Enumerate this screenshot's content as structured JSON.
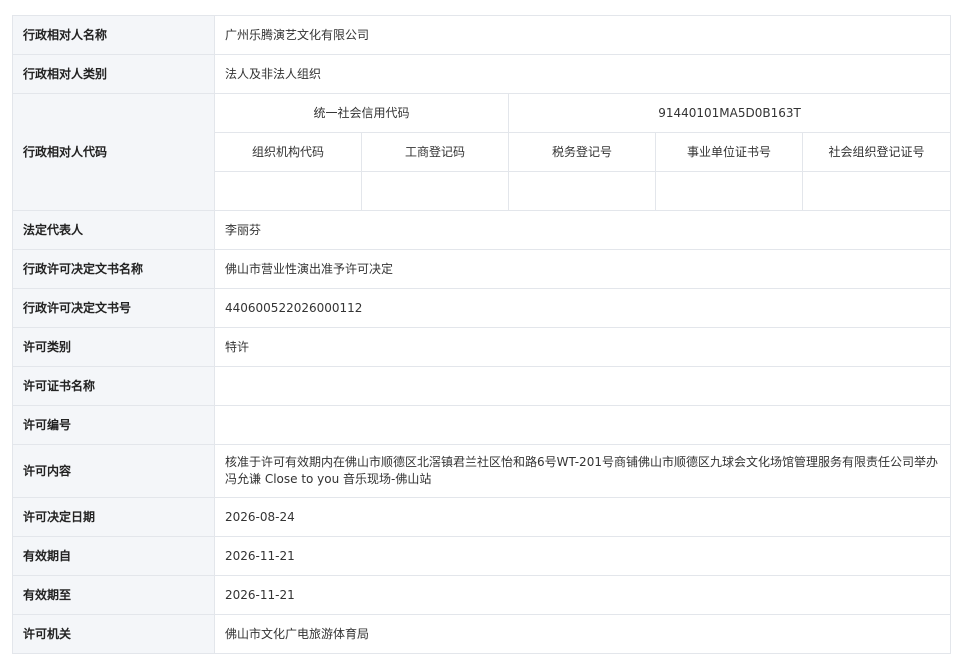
{
  "rows": {
    "name": {
      "label": "行政相对人名称",
      "value": "广州乐腾演艺文化有限公司"
    },
    "category": {
      "label": "行政相对人类别",
      "value": "法人及非法人组织"
    },
    "code": {
      "label": "行政相对人代码",
      "usc_label": "统一社会信用代码",
      "usc_value": "91440101MA5D0B163T",
      "sub_headers": [
        "组织机构代码",
        "工商登记码",
        "税务登记号",
        "事业单位证书号",
        "社会组织登记证号"
      ],
      "sub_values": [
        "",
        "",
        "",
        "",
        ""
      ]
    },
    "legal_rep": {
      "label": "法定代表人",
      "value": "李丽芬"
    },
    "doc_name": {
      "label": "行政许可决定文书名称",
      "value": "佛山市营业性演出准予许可决定"
    },
    "doc_no": {
      "label": "行政许可决定文书号",
      "value": "440600522026000112"
    },
    "permit_type": {
      "label": "许可类别",
      "value": "特许"
    },
    "cert_name": {
      "label": "许可证书名称",
      "value": ""
    },
    "permit_no": {
      "label": "许可编号",
      "value": ""
    },
    "content": {
      "label": "许可内容",
      "value": "核准于许可有效期内在佛山市顺德区北滘镇君兰社区怡和路6号WT-201号商铺佛山市顺德区九球会文化场馆管理服务有限责任公司举办冯允谦 Close to you 音乐现场-佛山站"
    },
    "decision_date": {
      "label": "许可决定日期",
      "value": "2026-08-24"
    },
    "valid_from": {
      "label": "有效期自",
      "value": "2026-11-21"
    },
    "valid_to": {
      "label": "有效期至",
      "value": "2026-11-21"
    },
    "authority": {
      "label": "许可机关",
      "value": "佛山市文化广电旅游体育局"
    }
  }
}
